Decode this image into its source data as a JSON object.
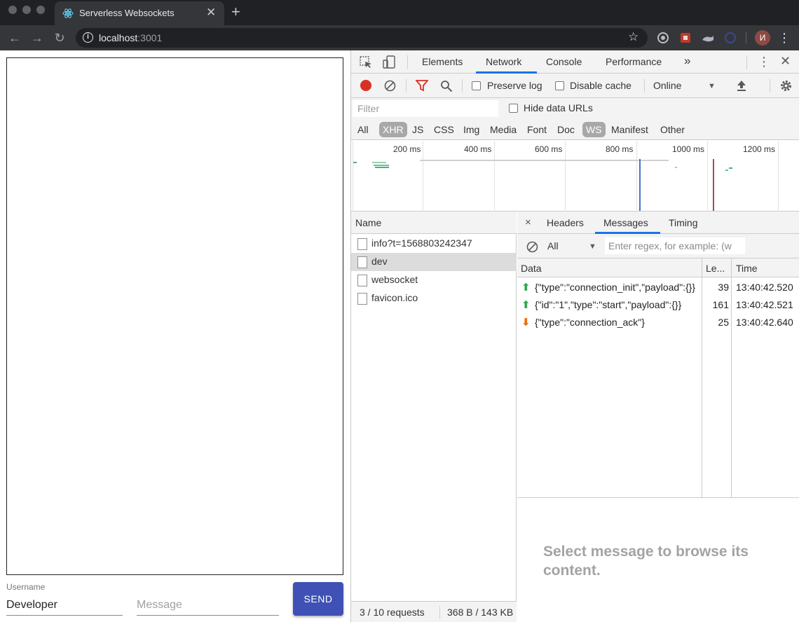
{
  "browser": {
    "tab_title": "Serverless Websockets",
    "tab_close": "✕",
    "new_tab": "+",
    "url_host": "localhost",
    "url_port": ":3001",
    "avatar_letter": "И",
    "icons": [
      "back-arrow-icon",
      "forward-arrow-icon",
      "reload-icon",
      "info-icon",
      "star-icon",
      "kebab-menu-icon"
    ]
  },
  "app": {
    "username_label": "Username",
    "username_value": "Developer",
    "message_placeholder": "Message",
    "send_label": "SEND",
    "accent_color": "#3f51b5"
  },
  "devtools": {
    "tabs": [
      "Elements",
      "Network",
      "Console",
      "Performance"
    ],
    "active_tab": "Network",
    "more_tabs": "»",
    "toolbar": {
      "preserve_log": "Preserve log",
      "disable_cache": "Disable cache",
      "throttling": "Online"
    },
    "filter_placeholder": "Filter",
    "hide_data_urls": "Hide data URLs",
    "types": [
      "All",
      "XHR",
      "JS",
      "CSS",
      "Img",
      "Media",
      "Font",
      "Doc",
      "WS",
      "Manifest",
      "Other"
    ],
    "active_types": [
      "XHR",
      "WS"
    ],
    "timeline_ticks": [
      "200 ms",
      "400 ms",
      "600 ms",
      "800 ms",
      "1000 ms",
      "1200 ms"
    ],
    "name_header": "Name",
    "requests": [
      {
        "name": "info?t=1568803242347",
        "selected": false
      },
      {
        "name": "dev",
        "selected": true
      },
      {
        "name": "websocket",
        "selected": false
      },
      {
        "name": "favicon.ico",
        "selected": false
      }
    ],
    "status": {
      "requests": "3 / 10 requests",
      "transferred": "368 B / 143 KB"
    },
    "detail_close": "×",
    "detail_tabs": [
      "Headers",
      "Messages",
      "Timing"
    ],
    "detail_active_tab": "Messages",
    "message_filter": {
      "type": "All",
      "regex_placeholder": "Enter regex, for example: (w"
    },
    "message_columns": [
      "Data",
      "Le...",
      "Time"
    ],
    "messages": [
      {
        "direction": "sent",
        "data": "{\"type\":\"connection_init\",\"payload\":{}}",
        "length": "39",
        "time": "13:40:42.520"
      },
      {
        "direction": "sent",
        "data": "{\"id\":\"1\",\"type\":\"start\",\"payload\":{}}",
        "length": "161",
        "time": "13:40:42.521"
      },
      {
        "direction": "received",
        "data": "{\"type\":\"connection_ack\"}",
        "length": "25",
        "time": "13:40:42.640"
      }
    ],
    "empty_message": "Select message to browse its content."
  }
}
